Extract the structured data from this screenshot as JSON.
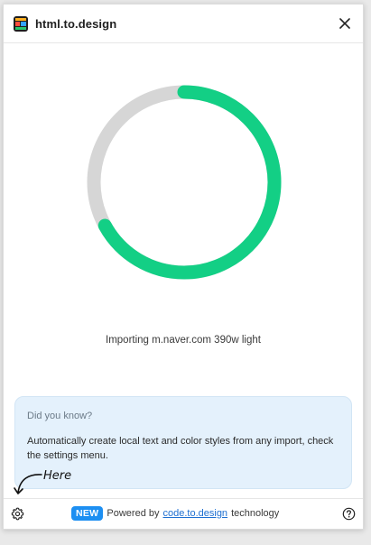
{
  "header": {
    "title": "html.to.design",
    "close_icon": "close-icon",
    "logo_icon": "app-logo-icon"
  },
  "progress": {
    "fraction": 0.67,
    "track_color": "#d6d6d6",
    "fill_color": "#13cf85"
  },
  "status": {
    "text": "Importing m.naver.com 390w light"
  },
  "tip": {
    "title": "Did you know?",
    "body": "Automatically create local text and color styles from any import, check the settings menu."
  },
  "annotation": {
    "text": "Here"
  },
  "footer": {
    "badge": "NEW",
    "powered_prefix": "Powered by",
    "link_text": "code.to.design",
    "powered_suffix": "technology",
    "settings_icon": "gear-icon",
    "help_icon": "help-icon"
  },
  "colors": {
    "accent": "#1d8ff2",
    "progress": "#13cf85",
    "tip_bg": "#e4f1fc"
  }
}
